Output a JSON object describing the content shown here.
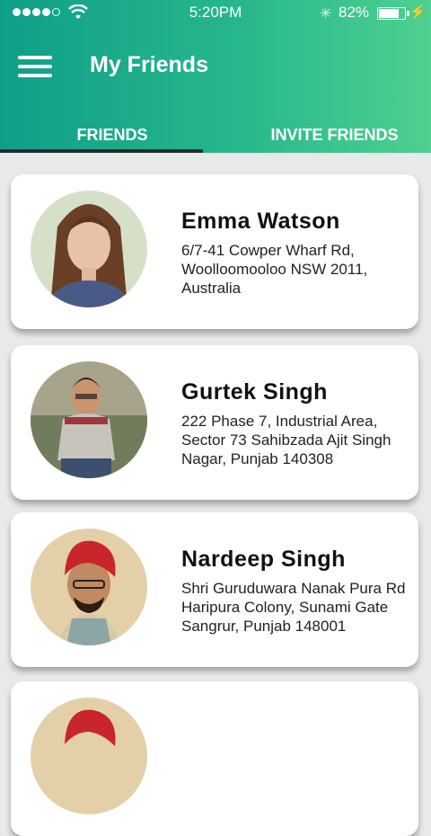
{
  "status_bar": {
    "time": "5:20PM",
    "battery": "82%",
    "signal_icon": "signal-dots-icon",
    "wifi_icon": "wifi-icon",
    "bluetooth_icon": "bluetooth-icon",
    "charging_icon": "charging-bolt-icon"
  },
  "header": {
    "title": "My Friends",
    "menu_icon": "hamburger-menu-icon",
    "gradient": [
      "#0f9f88",
      "#4fd08f"
    ]
  },
  "tabs": [
    {
      "label": "FRIENDS",
      "active": true
    },
    {
      "label": "INVITE FRIENDS",
      "active": false
    }
  ],
  "friends": [
    {
      "name": "Emma Watson",
      "address": "6/7-41 Cowper Wharf Rd, Woolloomooloo NSW 2011, Australia"
    },
    {
      "name": "Gurtek Singh",
      "address": "222 Phase 7, Industrial Area, Sector 73 Sahibzada Ajit Singh Nagar, Punjab 140308"
    },
    {
      "name": "Nardeep Singh",
      "address": "Shri Guruduwara Nanak Pura Rd Haripura Colony, Sunami Gate Sangrur, Punjab 148001"
    },
    {
      "name": "",
      "address": ""
    }
  ]
}
